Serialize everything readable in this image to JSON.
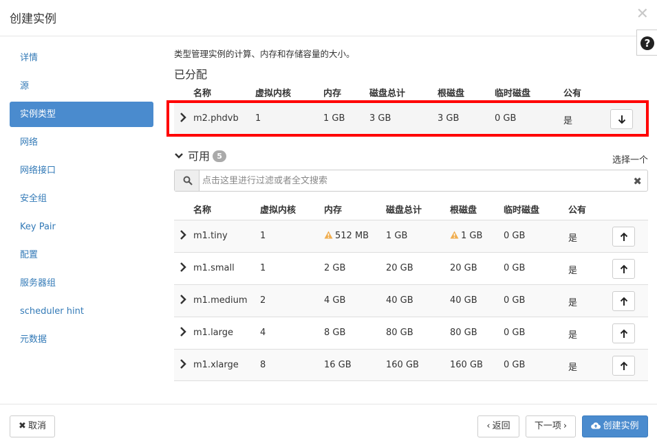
{
  "dialog": {
    "title": "创建实例"
  },
  "sidebar": {
    "items": [
      {
        "label": "详情"
      },
      {
        "label": "源"
      },
      {
        "label": "实例类型"
      },
      {
        "label": "网络"
      },
      {
        "label": "网络接口"
      },
      {
        "label": "安全组"
      },
      {
        "label": "Key Pair"
      },
      {
        "label": "配置"
      },
      {
        "label": "服务器组"
      },
      {
        "label": "scheduler hint"
      },
      {
        "label": "元数据"
      }
    ],
    "active_index": 2
  },
  "main": {
    "description": "类型管理实例的计算、内存和存储容量的大小。",
    "allocated_title": "已分配",
    "columns": [
      "名称",
      "虚拟内核",
      "内存",
      "磁盘总计",
      "根磁盘",
      "临时磁盘",
      "公有"
    ],
    "allocated": [
      {
        "name": "m2.phdvb",
        "vcpus": "1",
        "ram": "1 GB",
        "disk_total": "3 GB",
        "root_disk": "3 GB",
        "ephemeral": "0 GB",
        "public": "是"
      }
    ],
    "available_title": "可用",
    "available_count": "5",
    "select_one": "选择一个",
    "search_placeholder": "点击这里进行过滤或者全文搜索",
    "available": [
      {
        "name": "m1.tiny",
        "vcpus": "1",
        "ram": "512 MB",
        "disk_total": "1 GB",
        "root_disk": "1 GB",
        "ephemeral": "0 GB",
        "public": "是",
        "ram_warning": true,
        "root_warning": true
      },
      {
        "name": "m1.small",
        "vcpus": "1",
        "ram": "2 GB",
        "disk_total": "20 GB",
        "root_disk": "20 GB",
        "ephemeral": "0 GB",
        "public": "是"
      },
      {
        "name": "m1.medium",
        "vcpus": "2",
        "ram": "4 GB",
        "disk_total": "40 GB",
        "root_disk": "40 GB",
        "ephemeral": "0 GB",
        "public": "是"
      },
      {
        "name": "m1.large",
        "vcpus": "4",
        "ram": "8 GB",
        "disk_total": "80 GB",
        "root_disk": "80 GB",
        "ephemeral": "0 GB",
        "public": "是"
      },
      {
        "name": "m1.xlarge",
        "vcpus": "8",
        "ram": "16 GB",
        "disk_total": "160 GB",
        "root_disk": "160 GB",
        "ephemeral": "0 GB",
        "public": "是"
      }
    ]
  },
  "footer": {
    "cancel_label": "取消",
    "back_label": "返回",
    "next_label": "下一项",
    "create_label": "创建实例"
  },
  "colors": {
    "accent": "#4a8bce",
    "link": "#337ab7",
    "highlight": "#ff0000",
    "warning": "#f0ad4e"
  },
  "icons": {
    "close": "close-icon",
    "help": "help-icon",
    "search": "search-icon",
    "warning": "warning-icon"
  }
}
